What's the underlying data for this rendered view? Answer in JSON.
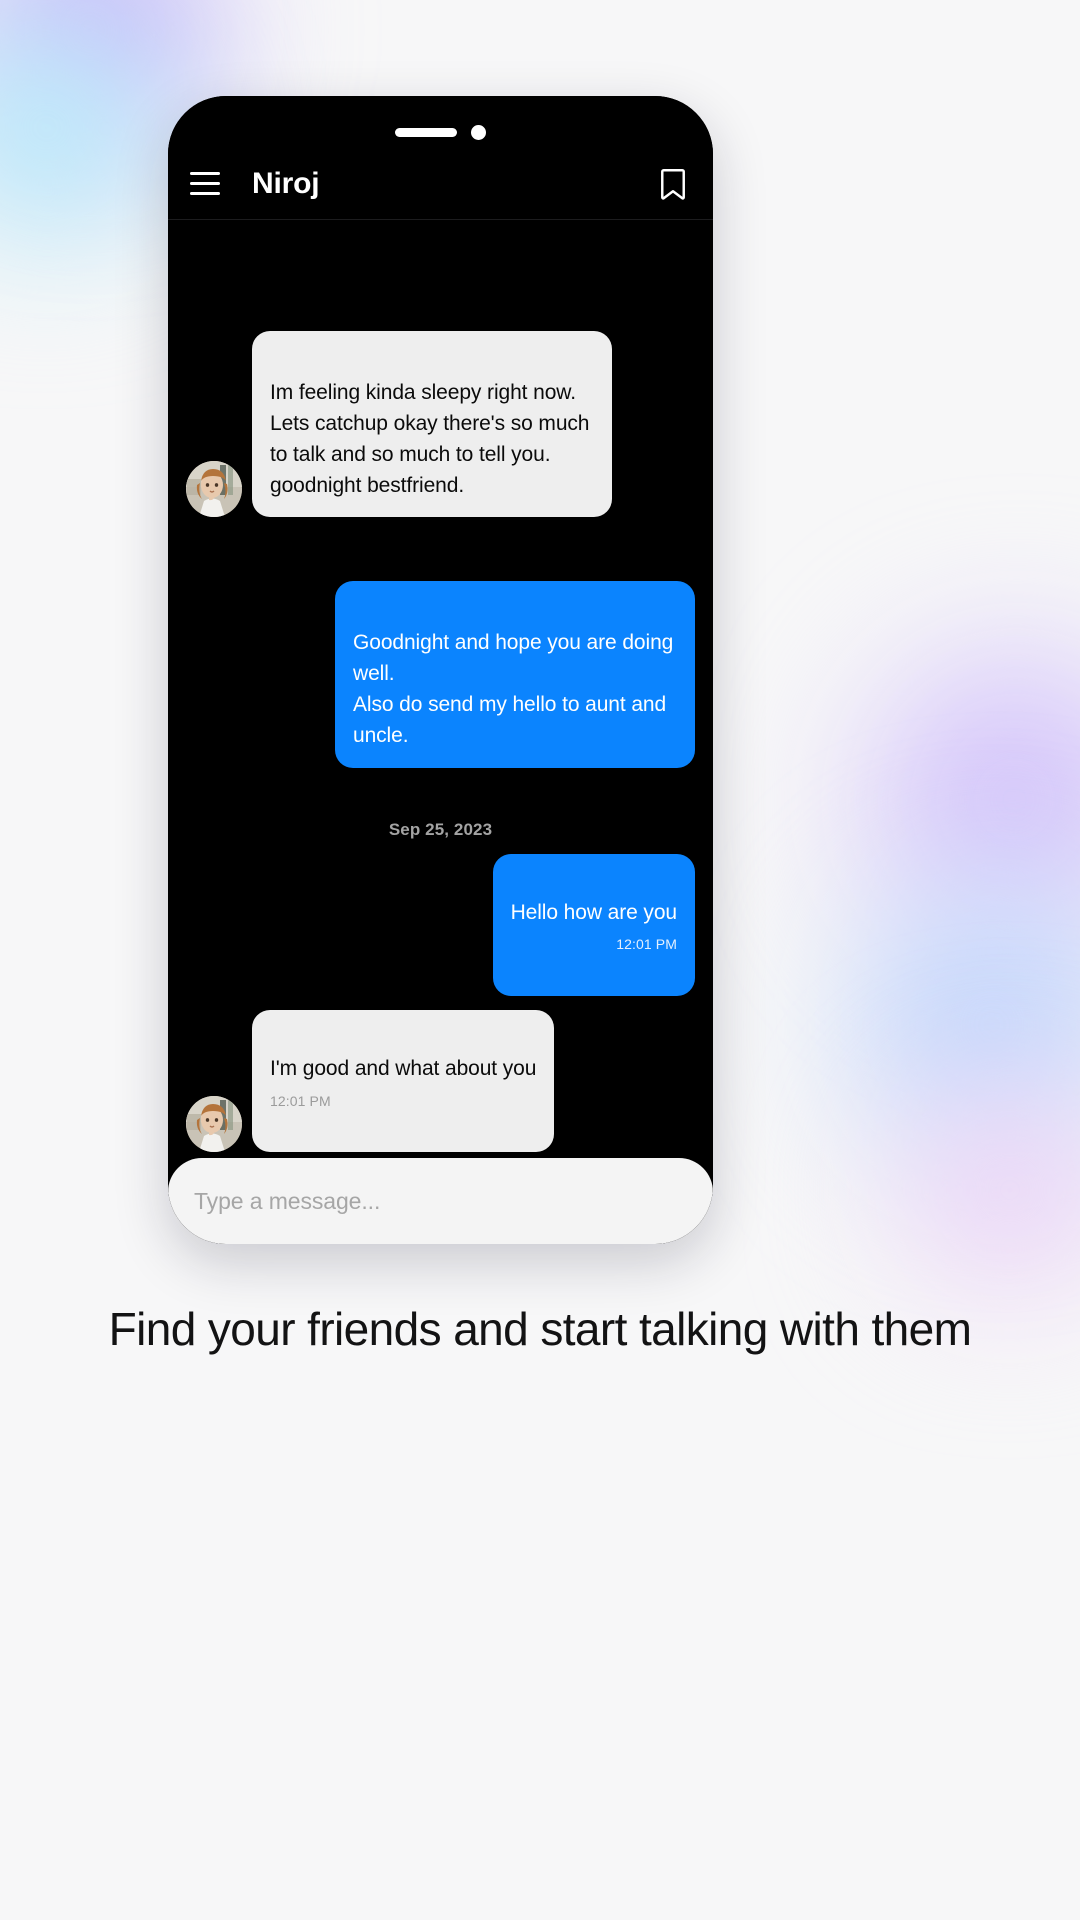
{
  "colors": {
    "accent_blue": "#0b84fe",
    "incoming_bubble": "#eeeeee",
    "screen_background": "#000000",
    "page_background": "#f7f7f8",
    "composer_background": "#f4f4f4"
  },
  "phone": {
    "status_bar": {
      "island_pill": "dynamic-island-pill",
      "camera_dot": "front-camera-dot"
    },
    "header": {
      "menu_icon": "hamburger-menu-icon",
      "title": "Niroj",
      "bookmark_icon": "bookmark-icon"
    },
    "conversation": {
      "date_divider": "Sep 25, 2023",
      "messages": [
        {
          "id": "msg-1",
          "direction": "incoming",
          "avatar": "contact-avatar",
          "text": "Im feeling kinda sleepy right now. Lets catchup okay there's so much to talk and so much to tell you.\ngoodnight bestfriend.",
          "time": ""
        },
        {
          "id": "msg-2",
          "direction": "outgoing",
          "text": "Goodnight and hope you are doing well.\nAlso do send my hello to aunt and uncle.",
          "time": ""
        },
        {
          "id": "msg-3",
          "direction": "outgoing",
          "text": "Hello how are you",
          "time": "12:01 PM"
        },
        {
          "id": "msg-4",
          "direction": "incoming",
          "avatar": "contact-avatar",
          "text": "I'm good and what about you",
          "time": "12:01 PM"
        }
      ]
    },
    "composer": {
      "placeholder": "Type a message...",
      "value": ""
    }
  },
  "caption": "Find your friends and start talking with them"
}
